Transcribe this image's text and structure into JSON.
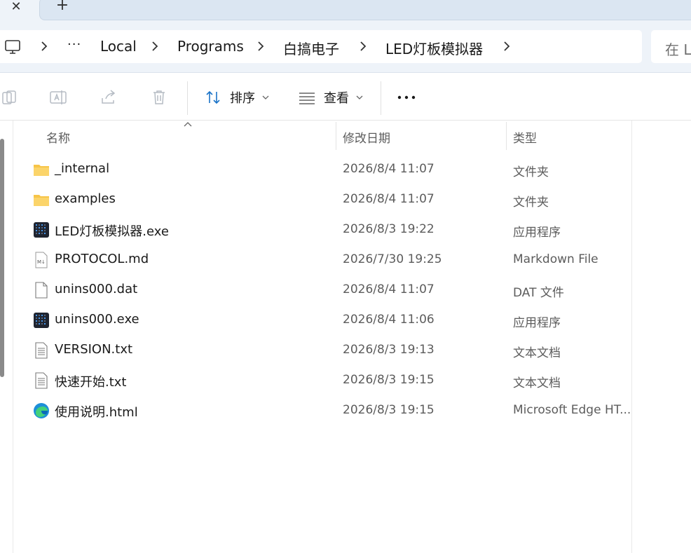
{
  "window": {
    "close_glyph": "✕",
    "new_tab_glyph": "+"
  },
  "breadcrumb": {
    "overflow": "···",
    "items": [
      "Local",
      "Programs",
      "白搞电子",
      "LED灯板模拟器"
    ]
  },
  "search": {
    "placeholder": "在 L"
  },
  "toolbar": {
    "sort_label": "排序",
    "view_label": "查看",
    "more_label": "···"
  },
  "columns": {
    "name": "名称",
    "modified": "修改日期",
    "type": "类型"
  },
  "files": [
    {
      "name": "_internal",
      "modified": "2026/8/4 11:07",
      "type": "文件夹",
      "icon": "folder-icon"
    },
    {
      "name": "examples",
      "modified": "2026/8/4 11:07",
      "type": "文件夹",
      "icon": "folder-icon"
    },
    {
      "name": "LED灯板模拟器.exe",
      "modified": "2026/8/3 19:22",
      "type": "应用程序",
      "icon": "app-icon"
    },
    {
      "name": "PROTOCOL.md",
      "modified": "2026/7/30 19:25",
      "type": "Markdown File",
      "icon": "markdown-file-icon"
    },
    {
      "name": "unins000.dat",
      "modified": "2026/8/4 11:07",
      "type": "DAT 文件",
      "icon": "blank-file-icon"
    },
    {
      "name": "unins000.exe",
      "modified": "2026/8/4 11:06",
      "type": "应用程序",
      "icon": "app-icon"
    },
    {
      "name": "VERSION.txt",
      "modified": "2026/8/3 19:13",
      "type": "文本文档",
      "icon": "text-file-icon"
    },
    {
      "name": "快速开始.txt",
      "modified": "2026/8/3 19:15",
      "type": "文本文档",
      "icon": "text-file-icon"
    },
    {
      "name": "使用说明.html",
      "modified": "2026/8/3 19:15",
      "type": "Microsoft Edge HT...",
      "icon": "edge-icon"
    }
  ],
  "colors": {
    "chrome_bg": "#eef3f9",
    "folder": "#f7c548",
    "accent": "#1a73c8"
  }
}
